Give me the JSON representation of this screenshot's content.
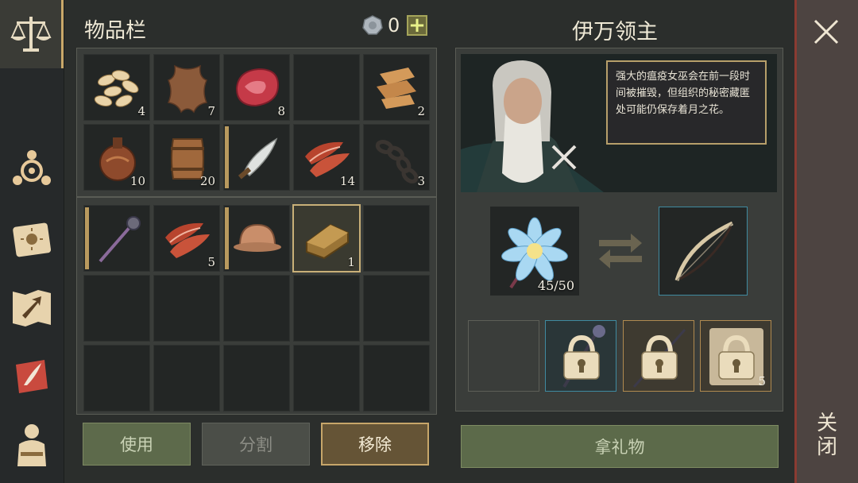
{
  "inventory": {
    "title": "物品栏",
    "currency_count": "0",
    "plus_label": "+",
    "slots_top": [
      {
        "icon": "seeds-icon",
        "qty": "4"
      },
      {
        "icon": "hide-icon",
        "qty": "7"
      },
      {
        "icon": "meat-icon",
        "qty": "8"
      },
      {
        "icon": "empty",
        "qty": ""
      },
      {
        "icon": "cloth-icon",
        "qty": "2"
      },
      {
        "icon": "flask-icon",
        "qty": "10"
      },
      {
        "icon": "barrel-icon",
        "qty": "20"
      },
      {
        "icon": "machete-icon",
        "qty": ""
      },
      {
        "icon": "bacon-icon",
        "qty": "14"
      },
      {
        "icon": "chain-icon",
        "qty": "3"
      }
    ],
    "slots_bottom": [
      {
        "icon": "mace-icon",
        "qty": ""
      },
      {
        "icon": "bacon-icon",
        "qty": "5"
      },
      {
        "icon": "helmet-icon",
        "qty": ""
      },
      {
        "icon": "ingot-icon",
        "qty": "1"
      }
    ],
    "buttons": {
      "use": "使用",
      "split": "分割",
      "remove": "移除"
    }
  },
  "npc": {
    "name": "伊万领主",
    "dialogue": "强大的瘟疫女巫会在前一段时间被摧毁，但组织的秘密藏匿处可能仍保存着月之花。",
    "trade": {
      "offer_icon": "moon-flower-icon",
      "offer_qty": "45/50",
      "receive_icon": "bow-icon"
    },
    "rewards": [
      {
        "icon": "empty",
        "qty": ""
      },
      {
        "icon": "locked-mace-icon",
        "qty": ""
      },
      {
        "icon": "locked-spear-icon",
        "qty": ""
      },
      {
        "icon": "locked-scroll-icon",
        "qty": "5"
      }
    ],
    "gift_button": "拿礼物"
  },
  "close": {
    "label": "关闭"
  },
  "colors": {
    "accent": "#c9a86a",
    "close_border": "#8a3b32",
    "green_button": "#5d6a4b"
  }
}
